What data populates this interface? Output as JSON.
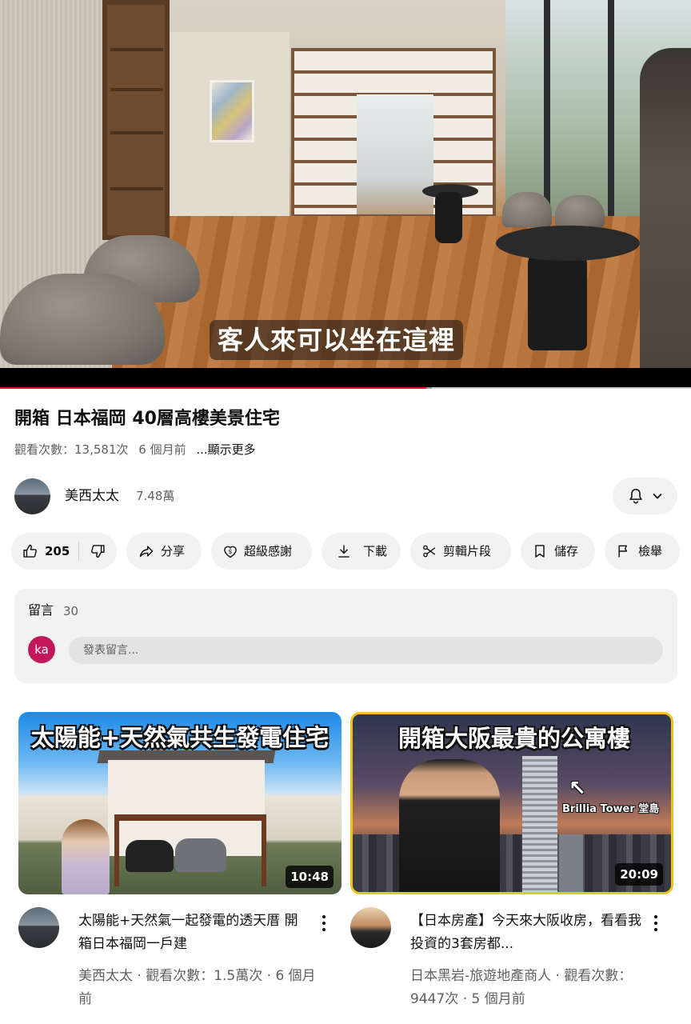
{
  "player": {
    "caption": "客人來可以坐在這裡",
    "progress_fraction": 0.617,
    "buffer_fraction": 0.625
  },
  "video": {
    "title": "開箱 日本福岡 40層高樓美景住宅",
    "views": "觀看次數：13,581次",
    "age": "6 個月前",
    "more": "...顯示更多"
  },
  "channel": {
    "name": "美西太太",
    "subscribers": "7.48萬",
    "bell_icon": "bell-icon",
    "chevron_icon": "chevron-down-icon"
  },
  "actions": {
    "like_count": "205",
    "share": "分享",
    "thanks": "超級感謝",
    "download": "下載",
    "clip": "剪輯片段",
    "save": "儲存",
    "report": "檢舉"
  },
  "comments": {
    "label": "留言",
    "count": "30",
    "user_initials": "ka",
    "placeholder": "發表留言..."
  },
  "recommendations": [
    {
      "thumb_title": "太陽能+天然氣共生發電住宅",
      "duration": "10:48",
      "title": "太陽能+天然氣一起發電的透天厝 開箱日本福岡一戶建",
      "meta": "美西太太 · 觀看次數：1.5萬次 · 6 個月前"
    },
    {
      "thumb_title": "開箱大阪最貴的公寓樓",
      "thumb_tag": "Brillia Tower 堂島",
      "duration": "20:09",
      "title": "【日本房產】今天來大阪收房，看看我投資的3套房都...",
      "meta": "日本黑岩-旅遊地產商人 · 觀看次數：9447次 · 5 個月前"
    }
  ],
  "colors": {
    "progress": "#ff0033",
    "pill_bg": "#f2f2f2",
    "secondary_text": "#606060",
    "user_avatar": "#c2185b",
    "thumb_border": "#f2c21d"
  }
}
